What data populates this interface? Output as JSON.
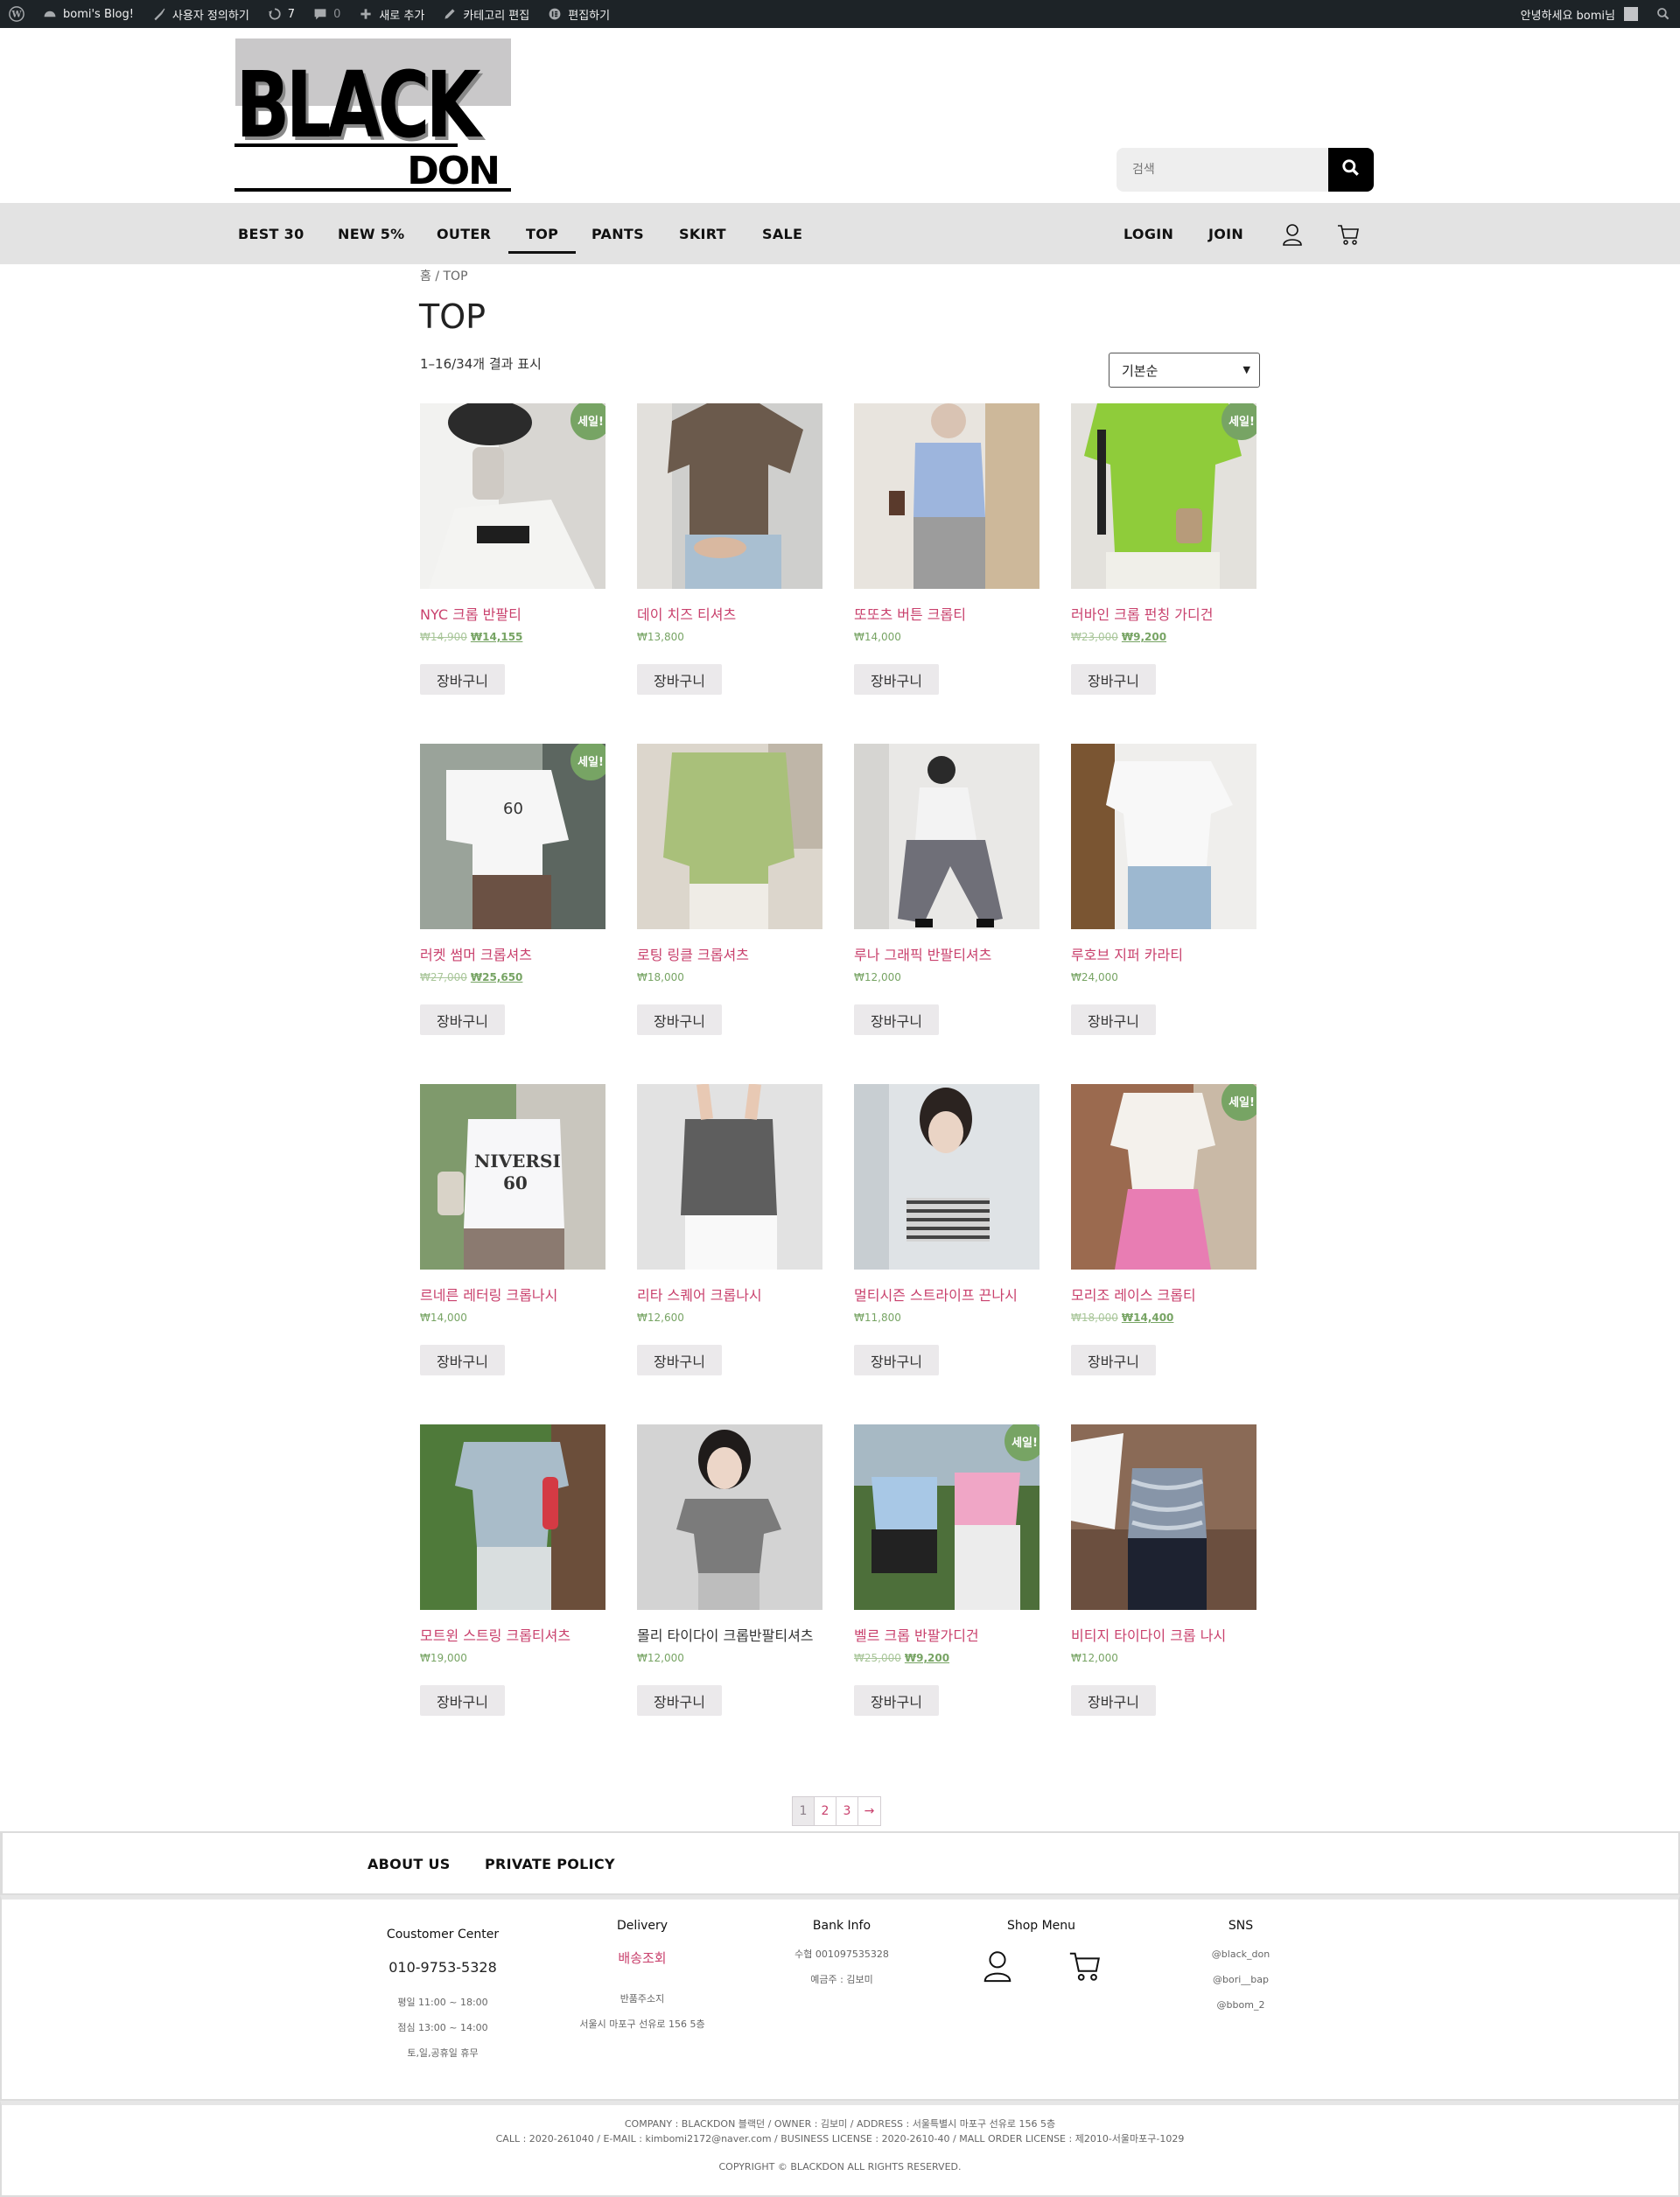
{
  "admin_bar": {
    "site_name": "bomi's Blog!",
    "customize": "사용자 정의하기",
    "updates_count": "7",
    "comments_count": "0",
    "new_label": "새로 추가",
    "edit_category": "카테고리 편집",
    "edit_with": "편집하기",
    "greeting": "안녕하세요 bomi님"
  },
  "header": {
    "logo_text_main": "BLACK",
    "logo_text_sub": "DON",
    "search_placeholder": "검색"
  },
  "nav": {
    "items": [
      "BEST 30",
      "NEW 5%",
      "OUTER",
      "TOP",
      "PANTS",
      "SKIRT",
      "SALE"
    ],
    "active": "TOP",
    "login": "LOGIN",
    "join": "JOIN"
  },
  "breadcrumb": "홈 / TOP",
  "page_title": "TOP",
  "result_count": "1–16/34개 결과 표시",
  "orderby": "기본순",
  "cart_label": "장바구니",
  "sale_badge": "세일!",
  "products": [
    {
      "name": "NYC 크롭 반팔티",
      "regular": "₩14,900",
      "price": "₩14,155",
      "sale": true
    },
    {
      "name": "데이 치즈 티셔츠",
      "price": "₩13,800",
      "sale": false
    },
    {
      "name": "또또츠 버튼 크롭티",
      "price": "₩14,000",
      "sale": false
    },
    {
      "name": "러바인 크롭 펀칭 가디건",
      "regular": "₩23,000",
      "price": "₩9,200",
      "sale": true
    },
    {
      "name": "러켓 썸머 크롭셔츠",
      "regular": "₩27,000",
      "price": "₩25,650",
      "sale": true
    },
    {
      "name": "로팅 링클 크롭셔츠",
      "price": "₩18,000",
      "sale": false
    },
    {
      "name": "루나 그래픽 반팔티셔츠",
      "price": "₩12,000",
      "sale": false
    },
    {
      "name": "루호브 지퍼 카라티",
      "price": "₩24,000",
      "sale": false
    },
    {
      "name": "르네른 레터링 크롭나시",
      "price": "₩14,000",
      "sale": false
    },
    {
      "name": "리타 스퀘어 크롭나시",
      "price": "₩12,600",
      "sale": false
    },
    {
      "name": "멀티시즌 스트라이프 끈나시",
      "price": "₩11,800",
      "sale": false
    },
    {
      "name": "모리조 레이스 크롭티",
      "regular": "₩18,000",
      "price": "₩14,400",
      "sale": true
    },
    {
      "name": "모트윈 스트링 크롭티셔츠",
      "price": "₩19,000",
      "sale": false
    },
    {
      "name": "몰리 타이다이 크롭반팔티셔츠",
      "price": "₩12,000",
      "sale": false
    },
    {
      "name": "벨르 크롭 반팔가디건",
      "regular": "₩25,000",
      "price": "₩9,200",
      "sale": true
    },
    {
      "name": "비티지 타이다이 크롭 나시",
      "price": "₩12,000",
      "sale": false
    }
  ],
  "pagination": [
    "1",
    "2",
    "3",
    "→"
  ],
  "footer": {
    "links": [
      "ABOUT US",
      "PRIVATE POLICY"
    ],
    "customer_center": {
      "title": "Coustomer Center",
      "phone": "010-9753-5328",
      "hours": [
        "평일 11:00 ~ 18:00",
        "점심 13:00 ~ 14:00",
        "토,일,공휴일 휴무"
      ]
    },
    "delivery": {
      "title": "Delivery",
      "link": "배송조회",
      "return_title": "반품주소지",
      "return_address": "서울시 마포구 선유로 156 5층"
    },
    "bank": {
      "title": "Bank Info",
      "account": "수협  001097535328",
      "holder": "예금주 : 김보미"
    },
    "shop_menu": {
      "title": "Shop Menu"
    },
    "sns": {
      "title": "SNS",
      "handles": [
        "@black_don",
        "@bori__bap",
        "@bbom_2"
      ]
    },
    "company_line1": "COMPANY : BLACKDON 블랙던 / OWNER : 김보미 / ADDRESS :  서울특별시 마포구 선유로 156 5층",
    "company_line2": "CALL : 2020-261040 / E-MAIL : kimbomi2172@naver.com / BUSINESS LICENSE : 2020-2610-40 / MALL ORDER LICENSE : 제2010-서울마포구-1029",
    "copyright": "COPYRIGHT © BLACKDON ALL RIGHTS RESERVED."
  }
}
